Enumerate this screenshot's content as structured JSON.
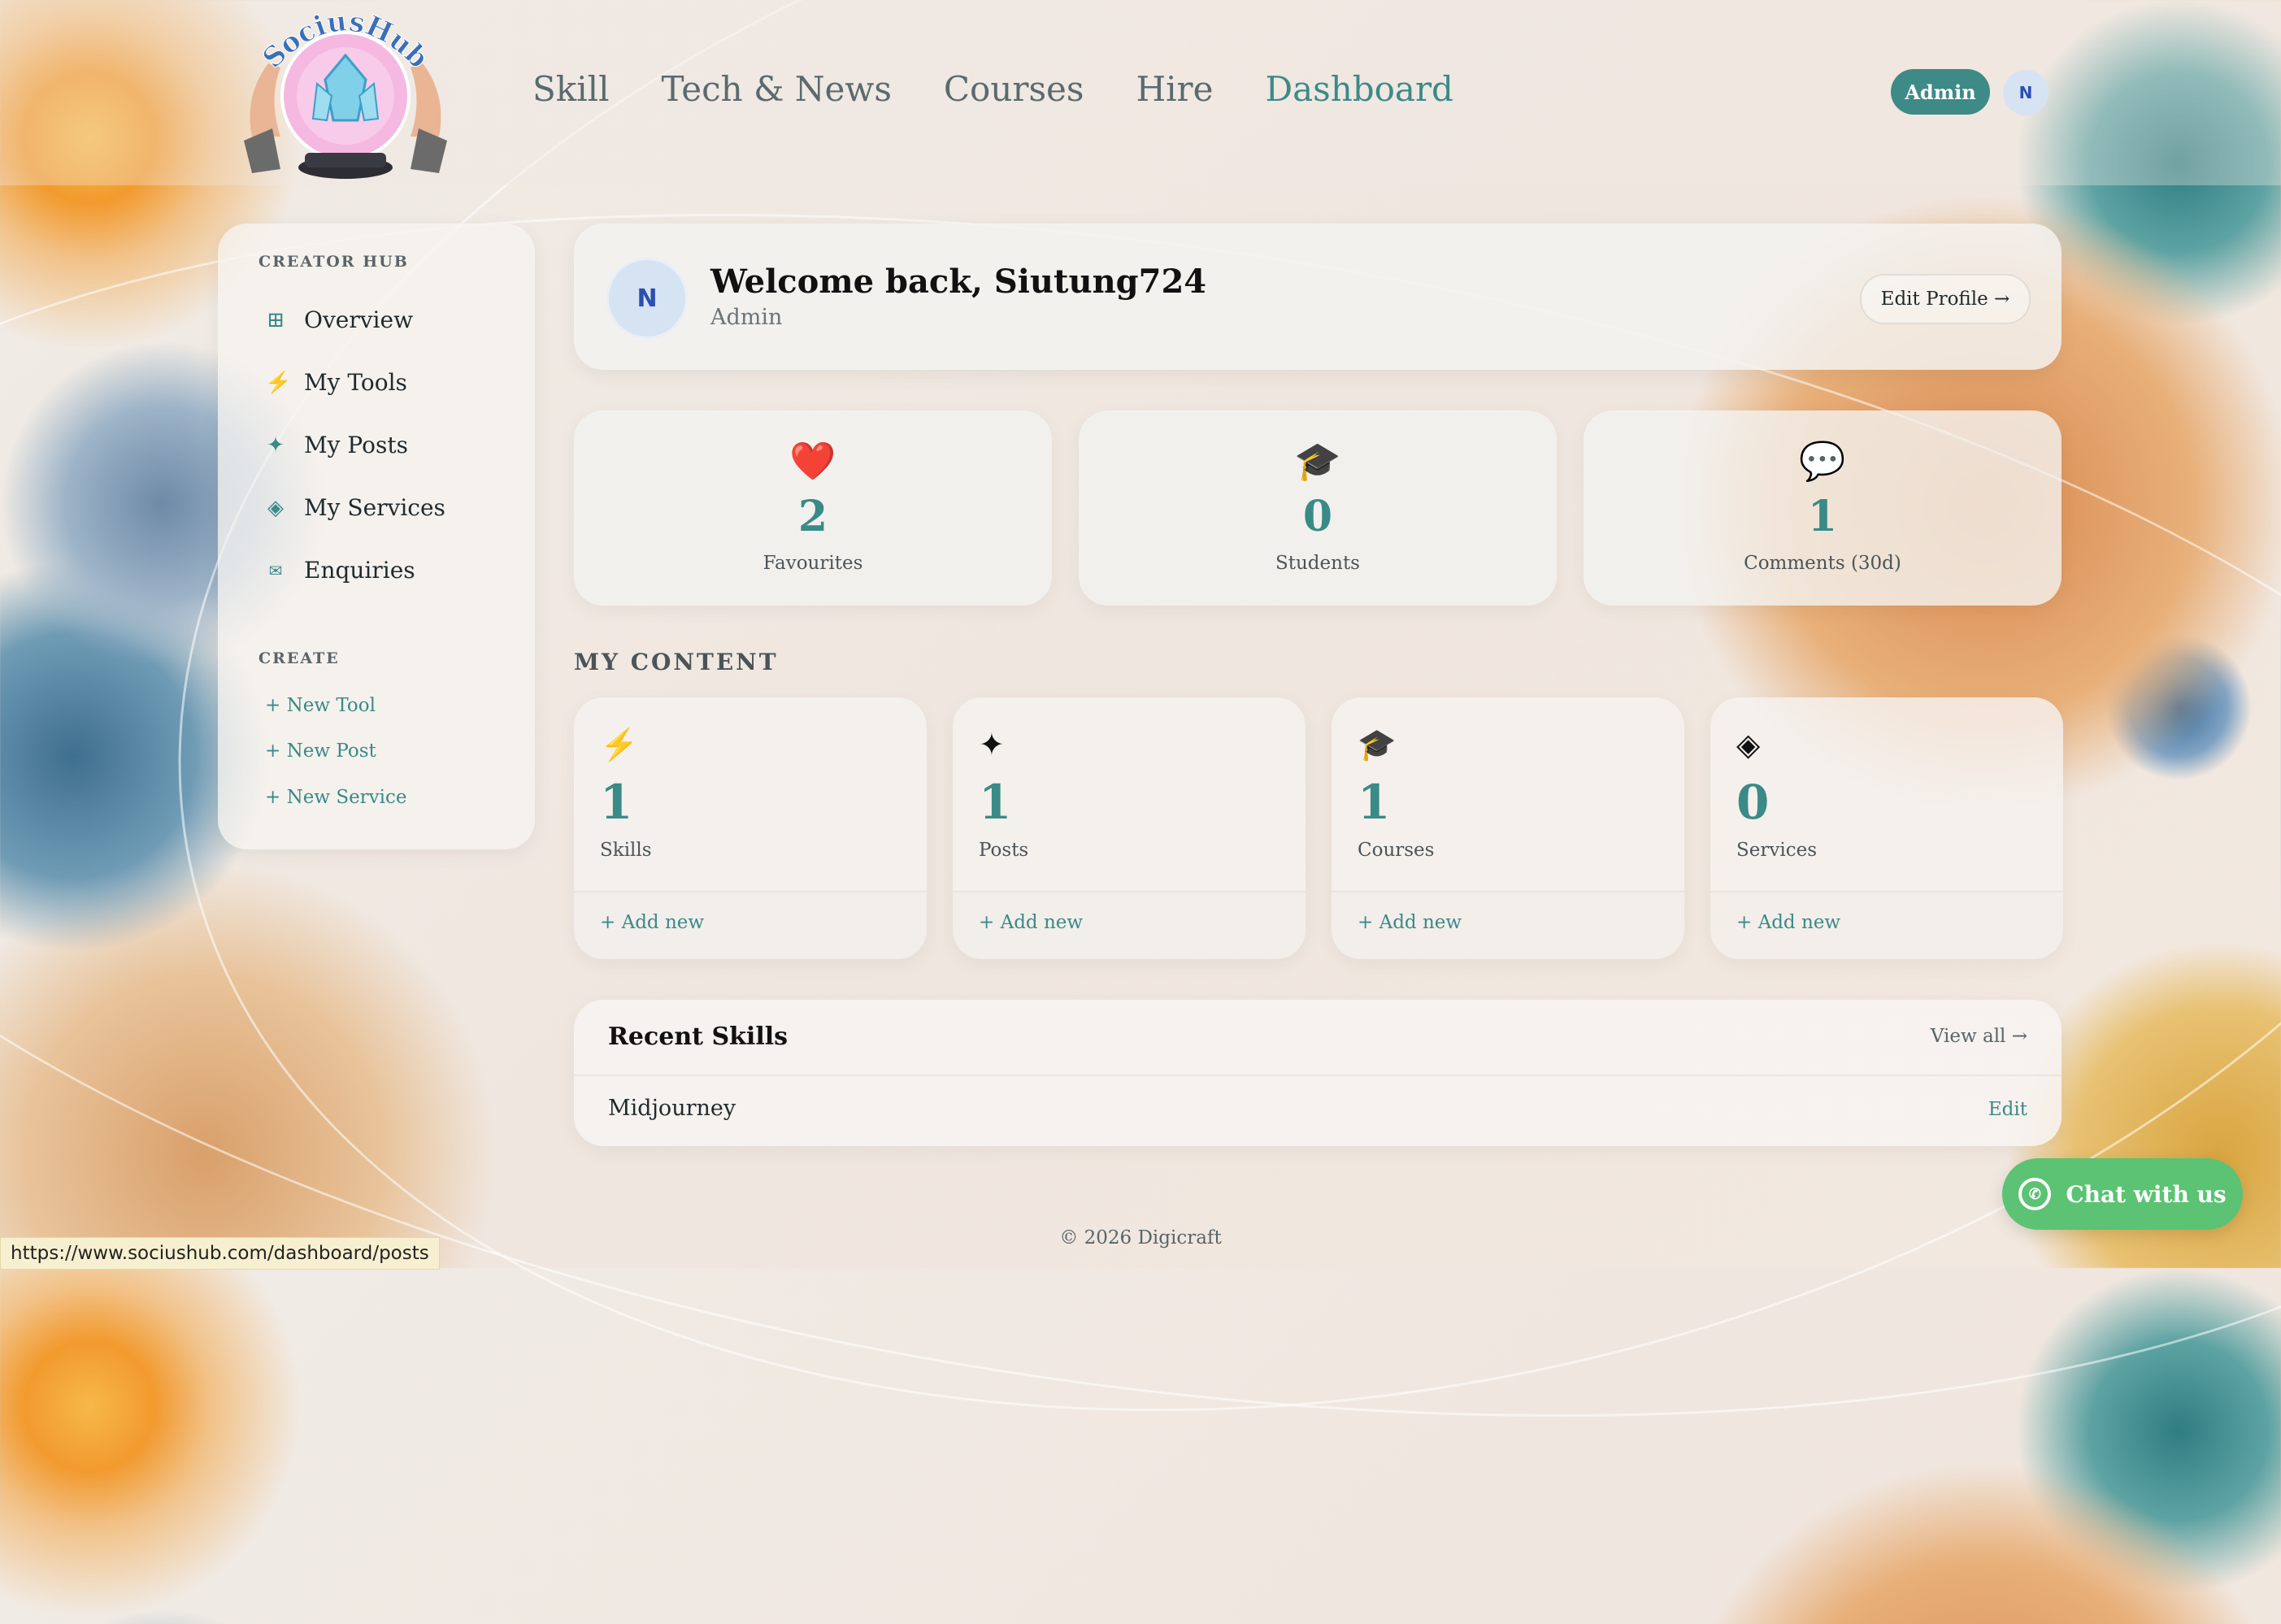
{
  "header": {
    "logo_text": "SociusHub",
    "nav": [
      {
        "label": "Skill"
      },
      {
        "label": "Tech & News"
      },
      {
        "label": "Courses"
      },
      {
        "label": "Hire"
      },
      {
        "label": "Dashboard",
        "active": true
      }
    ],
    "admin_badge": "Admin",
    "avatar_initial": "N"
  },
  "sidebar": {
    "section_label": "CREATOR HUB",
    "items": [
      {
        "icon": "grid-icon",
        "glyph": "⊞",
        "label": "Overview"
      },
      {
        "icon": "lightning-icon",
        "glyph": "⚡",
        "label": "My Tools"
      },
      {
        "icon": "sparkle-icon",
        "glyph": "✦",
        "label": "My Posts"
      },
      {
        "icon": "diamond-icon",
        "glyph": "◈",
        "label": "My Services"
      },
      {
        "icon": "envelope-icon",
        "glyph": "✉",
        "label": "Enquiries"
      }
    ],
    "create_label": "CREATE",
    "create_links": [
      "+ New Tool",
      "+ New Post",
      "+ New Service"
    ]
  },
  "welcome": {
    "avatar_initial": "N",
    "title": "Welcome back, Siutung724",
    "role": "Admin",
    "edit_profile": "Edit Profile →"
  },
  "stats": [
    {
      "icon": "heart-icon",
      "glyph": "❤️",
      "value": "2",
      "label": "Favourites"
    },
    {
      "icon": "graduation-cap-icon",
      "glyph": "🎓",
      "value": "0",
      "label": "Students"
    },
    {
      "icon": "speech-bubble-icon",
      "glyph": "💬",
      "value": "1",
      "label": "Comments (30d)"
    }
  ],
  "my_content": {
    "title": "MY CONTENT",
    "cards": [
      {
        "icon": "lightning-icon",
        "glyph": "⚡",
        "value": "1",
        "label": "Skills",
        "add": "+ Add new"
      },
      {
        "icon": "sparkle-icon",
        "glyph": "✦",
        "value": "1",
        "label": "Posts",
        "add": "+ Add new"
      },
      {
        "icon": "graduation-cap-icon",
        "glyph": "🎓",
        "value": "1",
        "label": "Courses",
        "add": "+ Add new"
      },
      {
        "icon": "diamond-icon",
        "glyph": "◈",
        "value": "0",
        "label": "Services",
        "add": "+ Add new"
      }
    ]
  },
  "recent_skills": {
    "title": "Recent Skills",
    "view_all": "View all →",
    "rows": [
      {
        "name": "Midjourney",
        "action": "Edit"
      }
    ]
  },
  "footer": {
    "copyright": "© 2026 Digicraft"
  },
  "chat": {
    "label": "Chat with us"
  },
  "status_url": "https://www.sociushub.com/dashboard/posts",
  "colors": {
    "accent": "#3a8a88",
    "admin_badge": "#3e8a86",
    "chat": "#5bc373"
  }
}
